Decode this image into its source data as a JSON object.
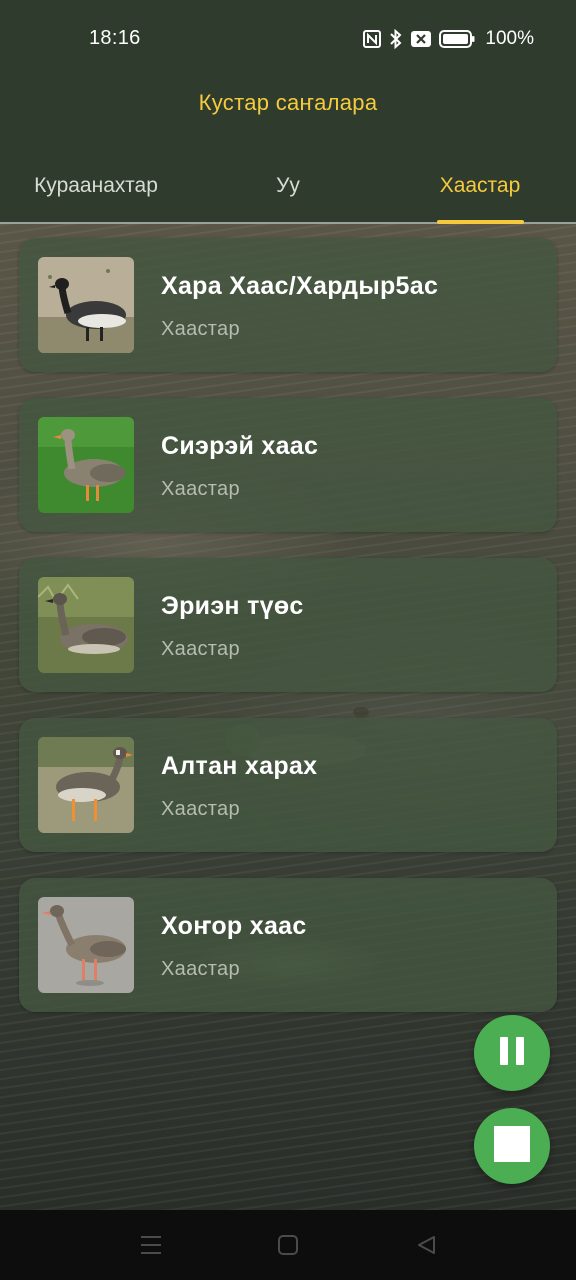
{
  "status_bar": {
    "time": "18:16",
    "battery_percent": "100%",
    "icons": [
      "nfc-icon",
      "bluetooth-icon",
      "notification-x-icon",
      "battery-icon"
    ]
  },
  "app": {
    "title": "Кустар саҥалара"
  },
  "tabs": [
    {
      "label": "Кураанахтар",
      "active": false
    },
    {
      "label": "Уу",
      "active": false
    },
    {
      "label": "Хаастар",
      "active": true
    }
  ],
  "birds": [
    {
      "name": "Хара Хаас/Хардыр5ас",
      "category": "Хаастар",
      "thumb": "brant-photo"
    },
    {
      "name": "Сиэрэй хаас",
      "category": "Хаастар",
      "thumb": "greylag-goose-photo"
    },
    {
      "name": "Эриэн түөс",
      "category": "Хаастар",
      "thumb": "bean-goose-photo"
    },
    {
      "name": "Алтан харах",
      "category": "Хаастар",
      "thumb": "white-fronted-goose-photo"
    },
    {
      "name": "Хоҥор хаас",
      "category": "Хаастар",
      "thumb": "greylag-on-road-photo"
    }
  ],
  "controls": {
    "pause_icon": "pause-icon",
    "stop_icon": "stop-icon"
  },
  "colors": {
    "accent": "#f4cb3e",
    "header_bg": "#2f3b2c",
    "card_bg": "#445640",
    "fab": "#4cae52"
  },
  "nav_bar": [
    "menu-icon",
    "home-icon",
    "back-icon"
  ]
}
